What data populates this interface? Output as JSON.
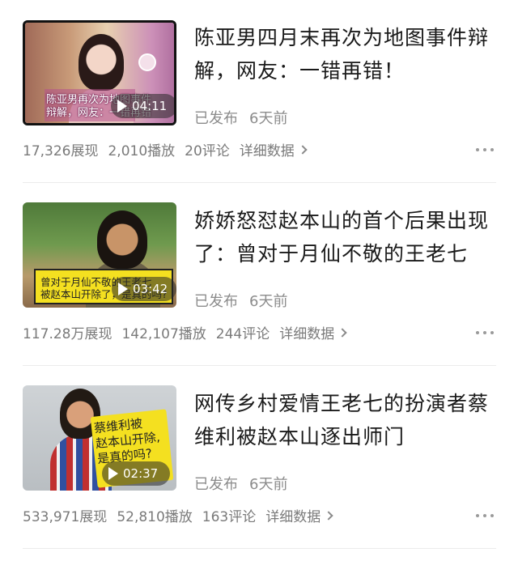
{
  "videos": [
    {
      "title": "陈亚男四月末再次为地图事件辩解，网友：一错再错！",
      "thumb_caption": [
        "陈亚男再次为地图事件",
        "辩解，网友：一错再错"
      ],
      "duration": "04:11",
      "status": "已发布",
      "time": "6天前",
      "views": "17,326展现",
      "plays": "2,010播放",
      "comments": "20评论",
      "detail": "详细数据"
    },
    {
      "title": "娇娇怒怼赵本山的首个后果出现了：曾对于月仙不敬的王老七",
      "thumb_caption": [
        "曾对于月仙不敬的王老七",
        "被赵本山开除了，是真的吗?"
      ],
      "duration": "03:42",
      "status": "已发布",
      "time": "6天前",
      "views": "117.28万展现",
      "plays": "142,107播放",
      "comments": "244评论",
      "detail": "详细数据"
    },
    {
      "title": "网传乡村爱情王老七的扮演者蔡维利被赵本山逐出师门",
      "thumb_caption": [
        "蔡维利被",
        "赵本山开除,",
        "是真的吗?"
      ],
      "duration": "02:37",
      "status": "已发布",
      "time": "6天前",
      "views": "533,971展现",
      "plays": "52,810播放",
      "comments": "163评论",
      "detail": "详细数据"
    }
  ]
}
